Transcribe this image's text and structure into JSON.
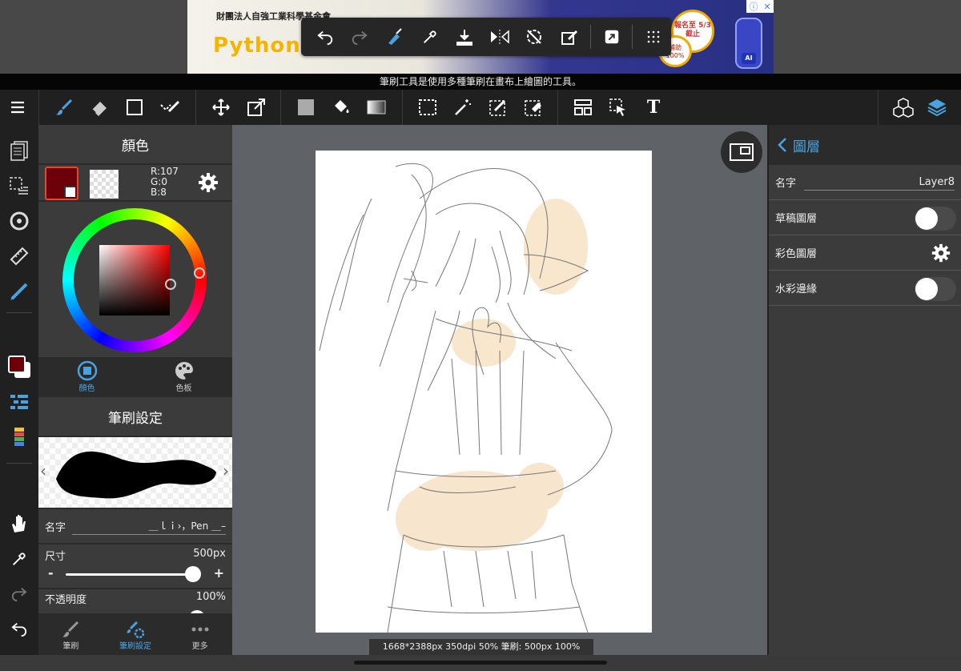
{
  "ad": {
    "org": "財團法人自強工業科學基金會",
    "headline": "Python",
    "badge": "報名至 5/3截止",
    "badge2": "補助 100%",
    "robot": "AI",
    "info_icon": "ⓘ",
    "close_icon": "✕"
  },
  "hint_text": "筆刷工具是使用多種筆刷在畫布上繪圖的工具。",
  "color_panel": {
    "title": "顏色",
    "r": "R:107",
    "g": "G:0",
    "b": "B:8",
    "primary_color": "#6b0008",
    "tab_color": "顏色",
    "tab_palette": "色板"
  },
  "brush_panel": {
    "title": "筆刷設定",
    "name_label": "名字",
    "name_value": "＿ｌｉ›，Pen ＿–",
    "size_label": "尺寸",
    "size_value": "500px",
    "size_fraction": 0.96,
    "opacity_label": "不透明度",
    "opacity_value": "100%",
    "minus": "-",
    "plus": "+"
  },
  "bottom_tabs": {
    "brush": "筆刷",
    "brush_settings": "筆刷設定",
    "more": "更多"
  },
  "status_text": "1668*2388px 350dpi 50% 筆刷: 500px 100%",
  "layer_panel": {
    "title": "圖層",
    "name_label": "名字",
    "name_value": "Layer8",
    "draft_label": "草稿圖層",
    "color_label": "彩色圖層",
    "watercolor_label": "水彩邊緣"
  },
  "toolbar": {
    "text_tool": "T"
  },
  "accent": "#4aa3e0"
}
